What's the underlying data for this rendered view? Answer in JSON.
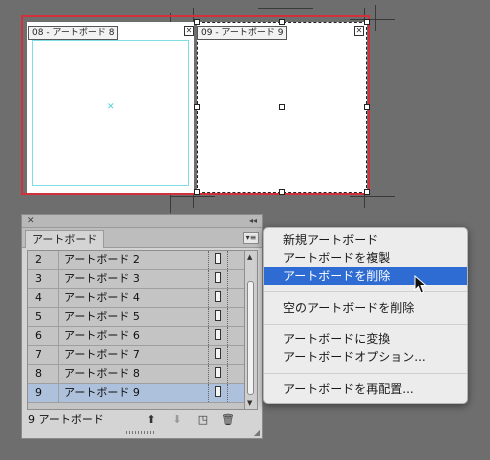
{
  "artboards_canvas": {
    "artboard_1_label": "08 - アートボード 8",
    "artboard_2_label": "09 - アートボード 9"
  },
  "panel": {
    "tab_label": "アートボード",
    "rows": [
      {
        "num": "2",
        "name": "アートボード 2",
        "selected": false
      },
      {
        "num": "3",
        "name": "アートボード 3",
        "selected": false
      },
      {
        "num": "4",
        "name": "アートボード 4",
        "selected": false
      },
      {
        "num": "5",
        "name": "アートボード 5",
        "selected": false
      },
      {
        "num": "6",
        "name": "アートボード 6",
        "selected": false
      },
      {
        "num": "7",
        "name": "アートボード 7",
        "selected": false
      },
      {
        "num": "8",
        "name": "アートボード 8",
        "selected": false
      },
      {
        "num": "9",
        "name": "アートボード 9",
        "selected": true
      }
    ],
    "footer_count": "9 アートボード"
  },
  "context_menu": {
    "items": [
      {
        "label": "新規アートボード",
        "highlighted": false
      },
      {
        "label": "アートボードを複製",
        "highlighted": false
      },
      {
        "label": "アートボードを削除",
        "highlighted": true
      },
      {
        "label": "空のアートボードを削除",
        "highlighted": false
      },
      {
        "label": "アートボードに変換",
        "highlighted": false
      },
      {
        "label": "アートボードオプション...",
        "highlighted": false
      },
      {
        "label": "アートボードを再配置...",
        "highlighted": false
      }
    ]
  },
  "icons": {
    "close": "close-icon",
    "collapse": "double-chevron-icon",
    "panel_menu": "panel-menu-icon",
    "move_up": "arrow-up-icon",
    "move_down": "arrow-down-icon",
    "new": "new-artboard-icon",
    "delete": "trash-icon",
    "cursor": "pointer-cursor-icon"
  },
  "colors": {
    "background": "#6e6e6e",
    "artboard_border": "#d2313b",
    "guide": "#7fdde6",
    "selected_row": "#aec1dc",
    "menu_highlight": "#2e6bd2"
  }
}
